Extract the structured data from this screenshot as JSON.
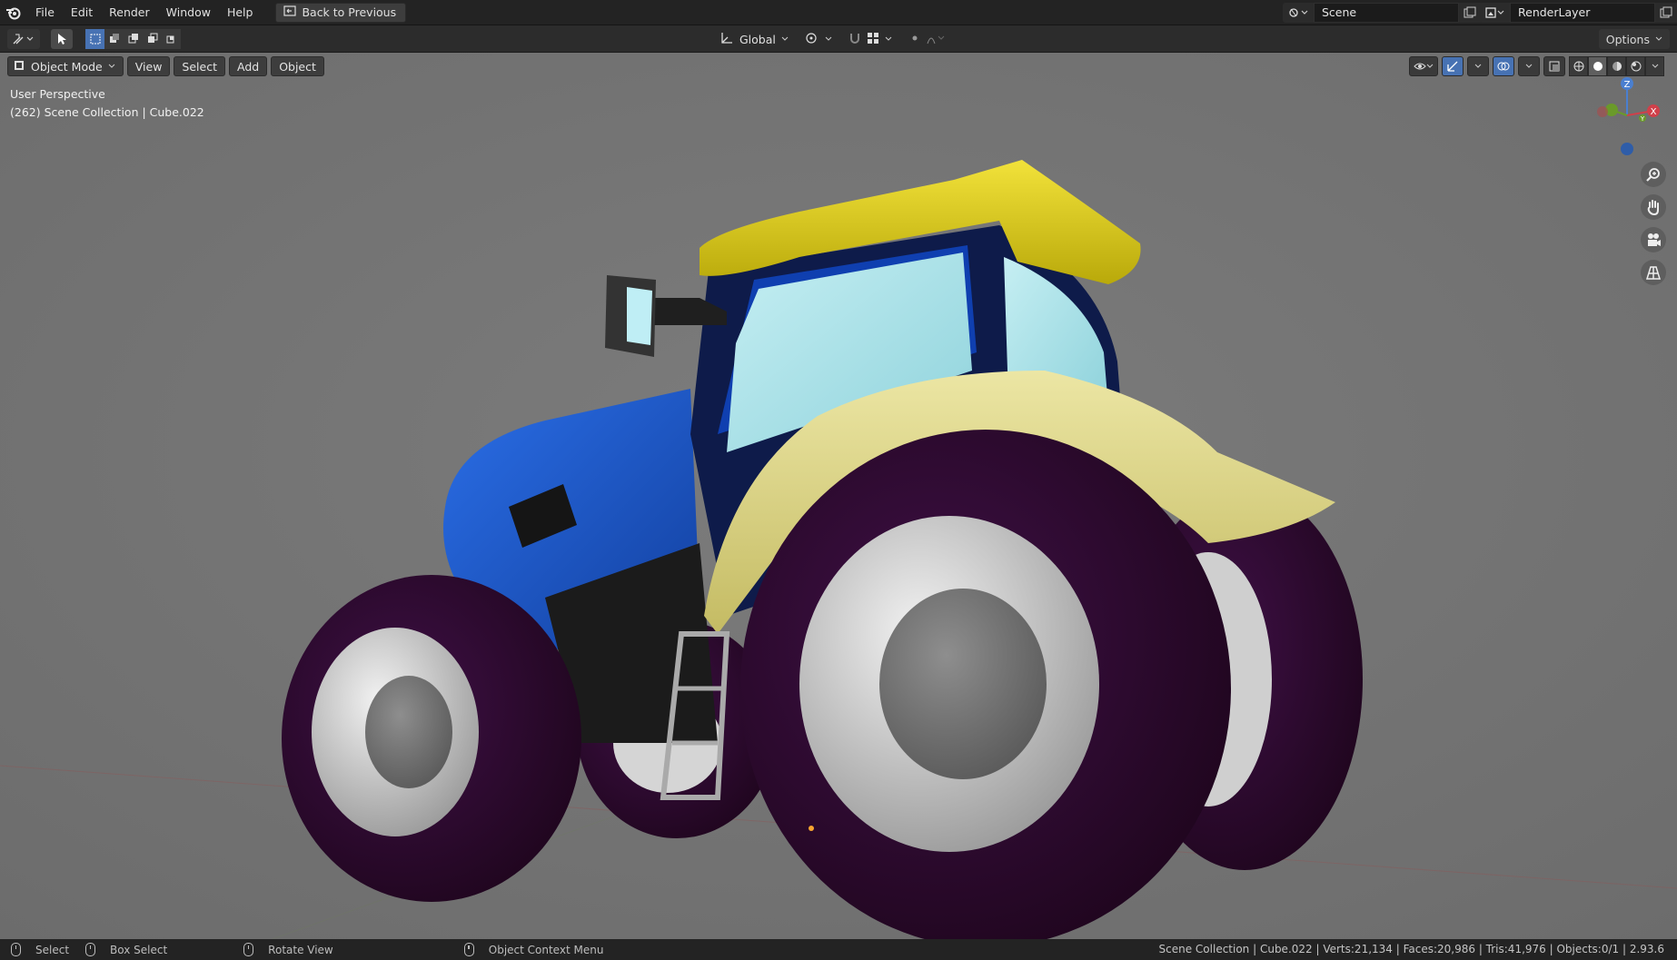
{
  "menubar": {
    "items": [
      "File",
      "Edit",
      "Render",
      "Window",
      "Help"
    ],
    "back_button": "Back to Previous",
    "scene_name": "Scene",
    "render_layer": "RenderLayer"
  },
  "toolbar": {
    "orientation": "Global",
    "options_label": "Options"
  },
  "viewport": {
    "mode": "Object Mode",
    "menus": [
      "View",
      "Select",
      "Add",
      "Object"
    ],
    "perspective_label": "User Perspective",
    "collection_label": "(262) Scene Collection | Cube.022",
    "gizmo_axes": {
      "x": "X",
      "y": "Y",
      "z": "Z"
    }
  },
  "statusbar": {
    "select": "Select",
    "box_select": "Box Select",
    "rotate_view": "Rotate View",
    "context_menu": "Object Context Menu",
    "stats": "Scene Collection | Cube.022 | Verts:21,134 | Faces:20,986 | Tris:41,976 | Objects:0/1 | 2.93.6"
  },
  "colors": {
    "accent": "#4772b3",
    "viewport_bg": "#747474",
    "tractor_body": "#1f5bd6",
    "tractor_roof": "#e5d40e",
    "fender": "#d8d07a",
    "tire": "#2c0a33",
    "rim": "#cfcfcf",
    "glass": "#a9e3ea"
  },
  "icons": [
    "blender-logo-icon",
    "back-icon",
    "scene-icon",
    "render-layer-icon",
    "editor-type-icon",
    "select-tool-icon",
    "transform-orientation-icon",
    "pivot-icon",
    "snap-icon",
    "proportional-icon",
    "visibility-icon",
    "gizmo-icon",
    "overlay-icon",
    "xray-icon",
    "wireframe-shading-icon",
    "solid-shading-icon",
    "material-shading-icon",
    "rendered-shading-icon",
    "zoom-icon",
    "pan-hand-icon",
    "camera-icon",
    "grid-icon",
    "mouse-icon"
  ]
}
